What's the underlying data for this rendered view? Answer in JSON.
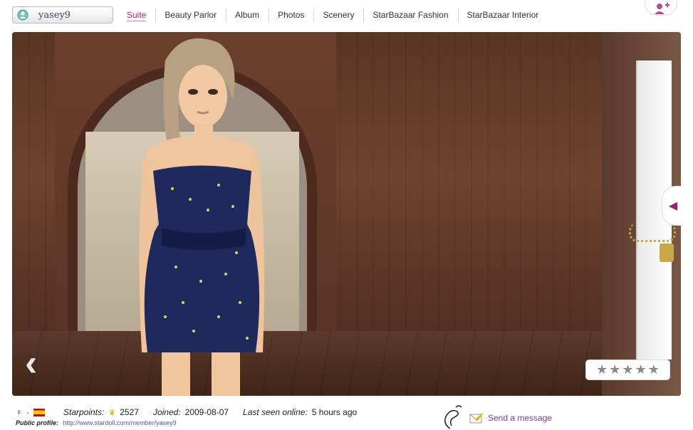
{
  "header": {
    "username": "yasey9",
    "tabs": [
      {
        "label": "Suite",
        "active": true
      },
      {
        "label": "Beauty Parlor",
        "active": false
      },
      {
        "label": "Album",
        "active": false
      },
      {
        "label": "Photos",
        "active": false
      },
      {
        "label": "Scenery",
        "active": false
      },
      {
        "label": "StarBazaar Fashion",
        "active": false
      },
      {
        "label": "StarBazaar Interior",
        "active": false
      }
    ],
    "add_friend_icon": "add-friend-icon"
  },
  "scene": {
    "rating_stars": 5,
    "prev_icon": "chevron-left-icon",
    "side_tab_icon": "triangle-left-icon"
  },
  "footer": {
    "gender_symbol": "♀",
    "dot": "·",
    "starpoints_label": "Starpoints:",
    "starpoints_value": "2527",
    "joined_label": "Joined:",
    "joined_value": "2009-08-07",
    "last_seen_label": "Last seen online:",
    "last_seen_value": "5 hours ago",
    "public_profile_label": "Public profile:",
    "public_profile_url": "http://www.stardoll.com/member/yasey9",
    "send_message_label": "Send a message"
  },
  "colors": {
    "accent": "#a6206b",
    "link": "#4a5fa8",
    "send": "#7a3c8e"
  }
}
